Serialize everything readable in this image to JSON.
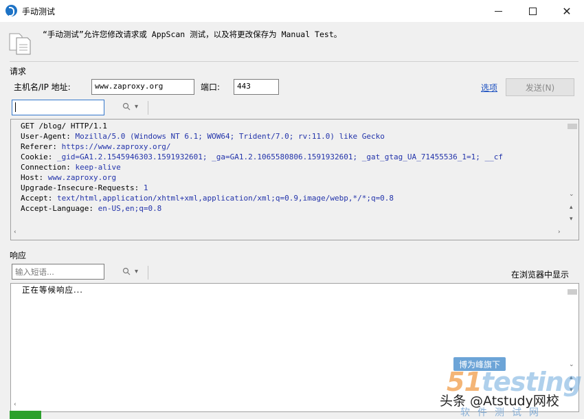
{
  "window": {
    "title": "手动测试",
    "icon": "appscan-logo-icon"
  },
  "intro": {
    "text": "“手动测试”允许您修改请求或 AppScan 测试，以及将更改保存为 Manual Test。"
  },
  "request": {
    "section_label": "请求",
    "host_label": "主机名/IP 地址:",
    "host_value": "www.zaproxy.org",
    "port_label": "端口:",
    "port_value": "443",
    "options_link": "选项",
    "send_button": "发送(N)",
    "lines": [
      {
        "k": "GET /blog/ HTTP/1.1",
        "v": ""
      },
      {
        "k": "User-Agent: ",
        "v": "Mozilla/5.0 (Windows NT 6.1; WOW64; Trident/7.0; rv:11.0) like Gecko"
      },
      {
        "k": "Referer: ",
        "v": "https://www.zaproxy.org/"
      },
      {
        "k": "Cookie: ",
        "v": "_gid=GA1.2.1545946303.1591932601; _ga=GA1.2.1065580806.1591932601; _gat_gtag_UA_71455536_1=1; __cf"
      },
      {
        "k": "Connection: ",
        "v": "keep-alive"
      },
      {
        "k": "Host: ",
        "v": "www.zaproxy.org"
      },
      {
        "k": "Upgrade-Insecure-Requests: ",
        "v": "1"
      },
      {
        "k": "Accept: ",
        "v": "text/html,application/xhtml+xml,application/xml;q=0.9,image/webp,*/*;q=0.8"
      },
      {
        "k": "Accept-Language: ",
        "v": "en-US,en;q=0.8"
      }
    ]
  },
  "response": {
    "section_label": "响应",
    "search_placeholder": "输入短语...",
    "show_in_browser": "在浏览器中显示",
    "body_text": "正在等候响应..."
  },
  "watermark": {
    "badge": "博为峰旗下",
    "logo_lead": "51",
    "logo_rest": "testing",
    "credit": "头条 @Atstudy网校",
    "site": "软件测试网"
  }
}
